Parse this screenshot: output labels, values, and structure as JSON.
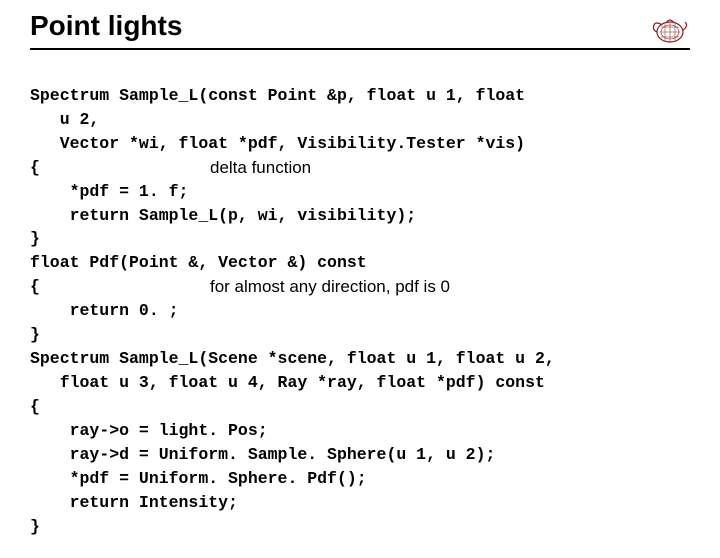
{
  "title": "Point lights",
  "annotations": {
    "delta": "delta function",
    "pdfzero": "for almost any direction, pdf is 0"
  },
  "code": {
    "l1": "Spectrum Sample_L(const Point &p, float u 1, float",
    "l2": "   u 2,",
    "l3": "   Vector *wi, float *pdf, Visibility.Tester *vis)",
    "l4": "{",
    "l5": "    *pdf = 1. f;",
    "l6": "    return Sample_L(p, wi, visibility);",
    "l7": "}",
    "l8": "float Pdf(Point &, Vector &) const",
    "l9": "{",
    "l10": "    return 0. ;",
    "l11": "}",
    "l12": "Spectrum Sample_L(Scene *scene, float u 1, float u 2,",
    "l13": "   float u 3, float u 4, Ray *ray, float *pdf) const",
    "l14": "{",
    "l15": "    ray->o = light. Pos;",
    "l16": "    ray->d = Uniform. Sample. Sphere(u 1, u 2);",
    "l17": "    *pdf = Uniform. Sphere. Pdf();",
    "l18": "    return Intensity;",
    "l19": "}"
  }
}
